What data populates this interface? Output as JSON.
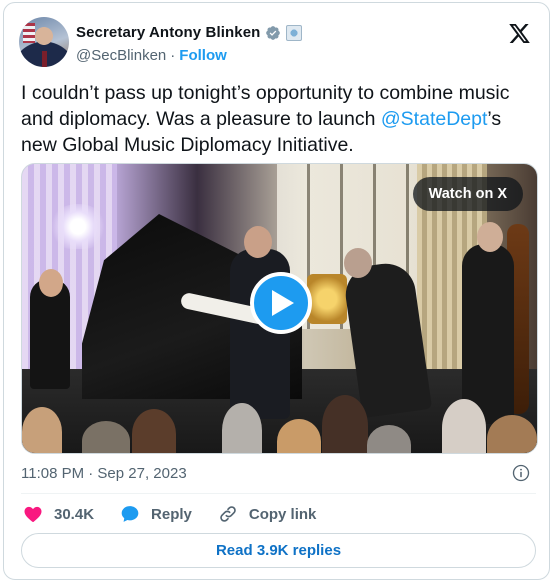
{
  "author": {
    "name": "Secretary Antony Blinken",
    "handle": "@SecBlinken",
    "follow_label": "Follow",
    "separator": "·"
  },
  "tweet": {
    "text_part1": "I couldn’t pass up tonight’s opportunity to combine music and diplomacy. Was a pleasure to launch ",
    "mention": "@StateDept",
    "text_part2": "’s new Global Music Diplomacy Initiative."
  },
  "media": {
    "watch_label": "Watch on X"
  },
  "meta": {
    "timestamp": "11:08 PM · Sep 27, 2023"
  },
  "actions": {
    "likes": "30.4K",
    "reply_label": "Reply",
    "copy_link_label": "Copy link"
  },
  "footer": {
    "read_replies_label": "Read 3.9K replies"
  },
  "colors": {
    "accent": "#1d9bf0",
    "like_heart": "#f91880",
    "text_secondary": "#536471",
    "border": "#cfd9de"
  },
  "icons": {
    "verified": "verified-badge-icon",
    "affiliation": "government-seal-icon",
    "brand": "x-logo-icon",
    "play": "play-icon",
    "info": "info-icon",
    "like": "heart-icon",
    "reply": "speech-bubble-icon",
    "copy_link": "link-icon"
  }
}
